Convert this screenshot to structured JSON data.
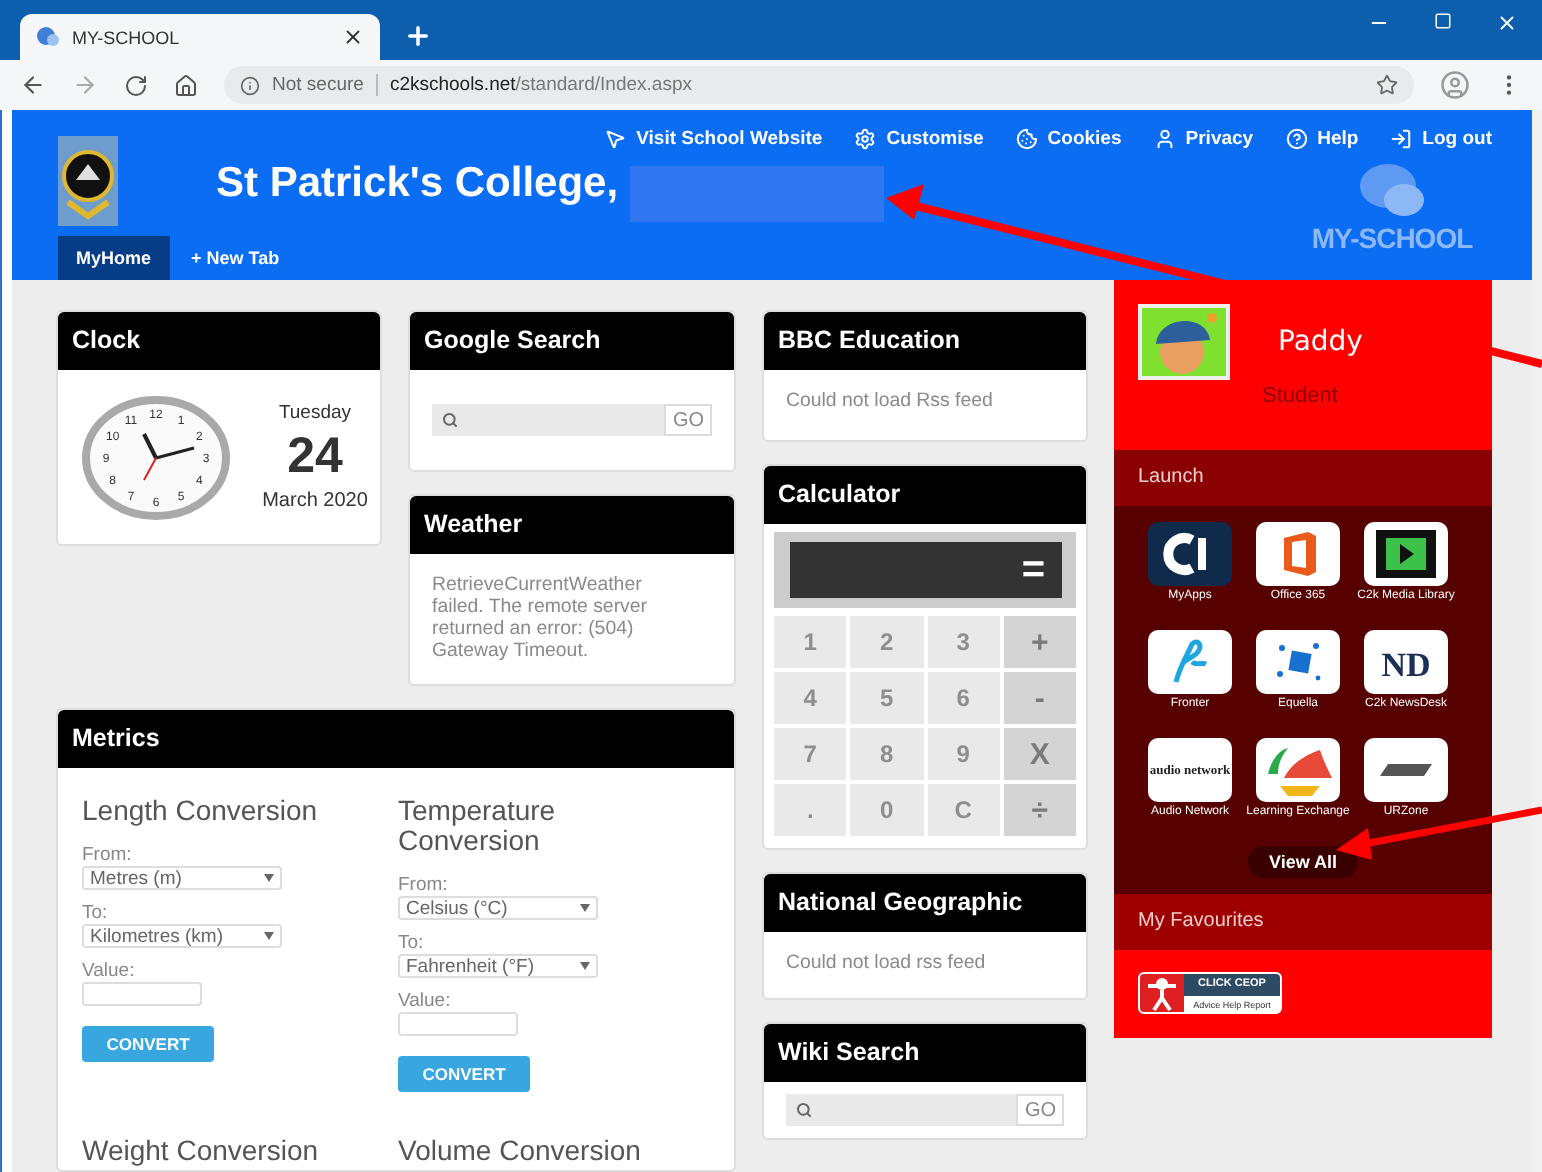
{
  "browser": {
    "tab_title": "MY-SCHOOL",
    "security": "Not secure",
    "url_domain": "c2kschools.net",
    "url_path": "/standard/Index.aspx"
  },
  "header": {
    "links": [
      {
        "label": "Visit School Website"
      },
      {
        "label": "Customise"
      },
      {
        "label": "Cookies"
      },
      {
        "label": "Privacy"
      },
      {
        "label": "Help"
      },
      {
        "label": "Log out"
      }
    ],
    "title": "St Patrick's College,",
    "brand": "MY-SCHOOL",
    "tabs": [
      {
        "label": "MyHome",
        "selected": true
      },
      {
        "label": "+ New Tab",
        "selected": false
      }
    ]
  },
  "clock": {
    "title": "Clock",
    "numerals": [
      "12",
      "1",
      "2",
      "3",
      "4",
      "5",
      "6",
      "7",
      "8",
      "9",
      "10",
      "11"
    ],
    "weekday": "Tuesday",
    "day": "24",
    "month_year": "March 2020"
  },
  "google": {
    "title": "Google Search",
    "button": "GO"
  },
  "weather": {
    "title": "Weather",
    "message": "RetrieveCurrentWeather failed. The remote server returned an error: (504) Gateway Timeout."
  },
  "metrics": {
    "title": "Metrics",
    "converters": [
      {
        "title": "Length Conversion",
        "from_label": "From:",
        "from": "Metres (m)",
        "to_label": "To:",
        "to": "Kilometres (km)",
        "value_label": "Value:",
        "button": "CONVERT"
      },
      {
        "title": "Temperature Conversion",
        "from_label": "From:",
        "from": "Celsius (°C)",
        "to_label": "To:",
        "to": "Fahrenheit (°F)",
        "value_label": "Value:",
        "button": "CONVERT"
      }
    ],
    "more": [
      "Weight Conversion",
      "Volume Conversion"
    ]
  },
  "bbc": {
    "title": "BBC Education",
    "message": "Could not load Rss feed"
  },
  "calculator": {
    "title": "Calculator",
    "equals": "=",
    "keys": [
      {
        "label": "1",
        "kind": "digit"
      },
      {
        "label": "2",
        "kind": "digit"
      },
      {
        "label": "3",
        "kind": "digit"
      },
      {
        "label": "+",
        "kind": "op"
      },
      {
        "label": "4",
        "kind": "digit"
      },
      {
        "label": "5",
        "kind": "digit"
      },
      {
        "label": "6",
        "kind": "digit"
      },
      {
        "label": "-",
        "kind": "op"
      },
      {
        "label": "7",
        "kind": "digit"
      },
      {
        "label": "8",
        "kind": "digit"
      },
      {
        "label": "9",
        "kind": "digit"
      },
      {
        "label": "X",
        "kind": "op"
      },
      {
        "label": ".",
        "kind": "digit"
      },
      {
        "label": "0",
        "kind": "digit"
      },
      {
        "label": "C",
        "kind": "digit"
      },
      {
        "label": "÷",
        "kind": "op"
      }
    ]
  },
  "natgeo": {
    "title": "National Geographic",
    "message": "Could not load rss feed"
  },
  "wiki": {
    "title": "Wiki Search",
    "button": "GO"
  },
  "profile": {
    "name": "Paddy",
    "role": "Student"
  },
  "launch": {
    "title": "Launch",
    "apps": [
      {
        "label": "MyApps"
      },
      {
        "label": "Office 365"
      },
      {
        "label": "C2k Media Library"
      },
      {
        "label": "Fronter"
      },
      {
        "label": "Equella"
      },
      {
        "label": "C2k NewsDesk",
        "logo_text": "ND"
      },
      {
        "label": "Audio Network",
        "logo_text": "audio network"
      },
      {
        "label": "Learning Exchange"
      },
      {
        "label": "URZone"
      }
    ],
    "view_all": "View All"
  },
  "favourites": {
    "title": "My Favourites",
    "badge_title": "CLICK CEOP",
    "badge_subtitle": "Advice Help Report"
  }
}
